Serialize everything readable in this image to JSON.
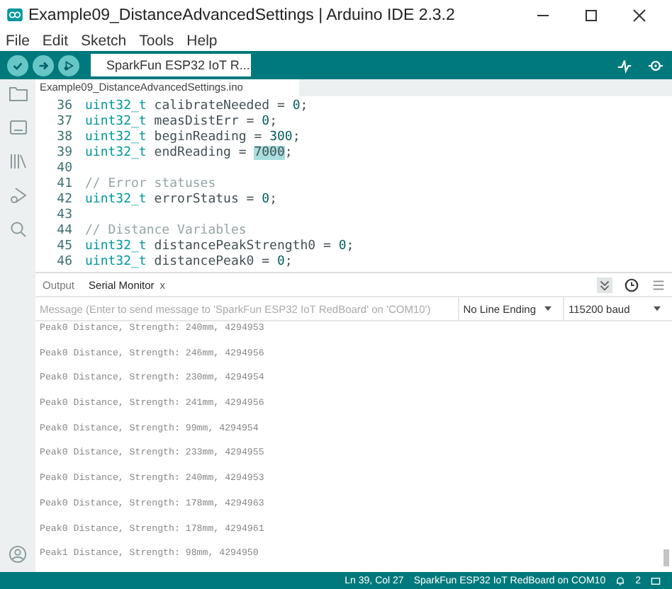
{
  "window": {
    "title": "Example09_DistanceAdvancedSettings | Arduino IDE 2.3.2"
  },
  "menu": [
    "File",
    "Edit",
    "Sketch",
    "Tools",
    "Help"
  ],
  "toolbar": {
    "board": "SparkFun ESP32 IoT R..."
  },
  "editor": {
    "tab": "Example09_DistanceAdvancedSettings.ino",
    "lines": [
      {
        "number": "36",
        "parts": [
          {
            "kind": "type",
            "text": "uint32_t"
          },
          {
            "kind": "plain",
            "text": " calibrateNeeded = "
          },
          {
            "kind": "number",
            "text": "0"
          },
          {
            "kind": "plain",
            "text": ";"
          }
        ]
      },
      {
        "number": "37",
        "parts": [
          {
            "kind": "type",
            "text": "uint32_t"
          },
          {
            "kind": "plain",
            "text": " measDistErr = "
          },
          {
            "kind": "number",
            "text": "0"
          },
          {
            "kind": "plain",
            "text": ";"
          }
        ]
      },
      {
        "number": "38",
        "parts": [
          {
            "kind": "type",
            "text": "uint32_t"
          },
          {
            "kind": "plain",
            "text": " beginReading = "
          },
          {
            "kind": "number",
            "text": "300"
          },
          {
            "kind": "plain",
            "text": ";"
          }
        ]
      },
      {
        "number": "39",
        "parts": [
          {
            "kind": "type",
            "text": "uint32_t"
          },
          {
            "kind": "plain",
            "text": " endReading = "
          },
          {
            "kind": "selected",
            "text": "7000"
          },
          {
            "kind": "plain",
            "text": ";"
          }
        ]
      },
      {
        "number": "40"
      },
      {
        "number": "41",
        "parts": [
          {
            "kind": "comment",
            "text": "// Error statuses"
          }
        ]
      },
      {
        "number": "42",
        "parts": [
          {
            "kind": "type",
            "text": "uint32_t"
          },
          {
            "kind": "plain",
            "text": " errorStatus = "
          },
          {
            "kind": "number",
            "text": "0"
          },
          {
            "kind": "plain",
            "text": ";"
          }
        ]
      },
      {
        "number": "43"
      },
      {
        "number": "44",
        "parts": [
          {
            "kind": "comment",
            "text": "// Distance Variables"
          }
        ]
      },
      {
        "number": "45",
        "parts": [
          {
            "kind": "type",
            "text": "uint32_t"
          },
          {
            "kind": "plain",
            "text": " distancePeakStrength0 = "
          },
          {
            "kind": "number",
            "text": "0"
          },
          {
            "kind": "plain",
            "text": ";"
          }
        ]
      },
      {
        "number": "46",
        "parts": [
          {
            "kind": "type",
            "text": "uint32_t"
          },
          {
            "kind": "plain",
            "text": " distancePeak0 = "
          },
          {
            "kind": "number",
            "text": "0"
          },
          {
            "kind": "plain",
            "text": ";"
          }
        ]
      }
    ]
  },
  "panel": {
    "tabs": [
      {
        "label": "Output",
        "selected": false,
        "closable": false
      },
      {
        "label": "Serial Monitor",
        "selected": true,
        "closable": true
      }
    ],
    "close_glyph": "x",
    "autoscroll": true,
    "message": {
      "placeholder": "Message (Enter to send message to 'SparkFun ESP32 IoT RedBoard' on 'COM10')"
    },
    "line_ending": "No Line Ending",
    "baud": "115200 baud",
    "output": [
      "Peak0 Distance, Strength: 240mm, 4294953",
      "Peak0 Distance, Strength: 246mm, 4294956",
      "Peak0 Distance, Strength: 230mm, 4294954",
      "Peak0 Distance, Strength: 241mm, 4294956",
      "Peak0 Distance, Strength: 99mm, 4294954",
      "Peak0 Distance, Strength: 233mm, 4294955",
      "Peak0 Distance, Strength: 240mm, 4294953",
      "Peak0 Distance, Strength: 178mm, 4294963",
      "Peak0 Distance, Strength: 178mm, 4294961",
      "Peak1 Distance, Strength: 98mm, 4294950"
    ]
  },
  "status_bar": {
    "position": "Ln 39, Col 27",
    "board": "SparkFun ESP32 IoT RedBoard on COM10",
    "notifications": "2"
  }
}
